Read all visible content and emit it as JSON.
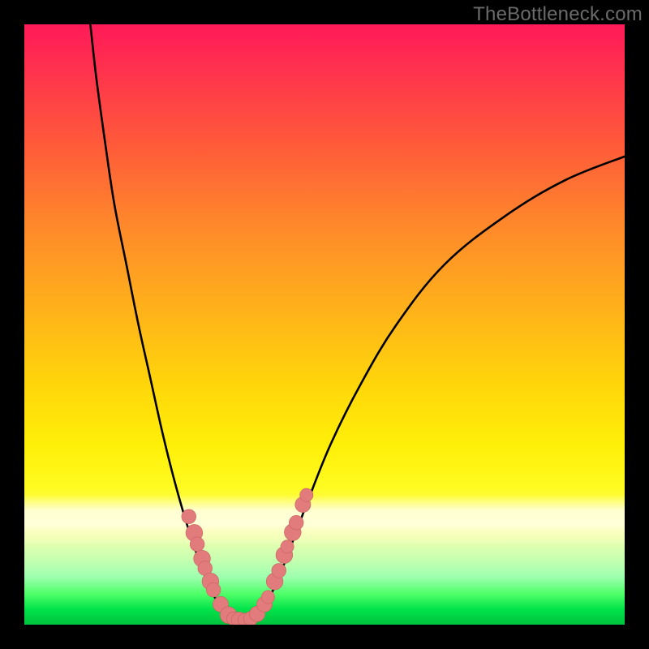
{
  "watermark": "TheBottleneck.com",
  "colors": {
    "page_bg": "#000000",
    "gradient_top": "#ff1a58",
    "gradient_mid_orange": "#ff8a2a",
    "gradient_yellow": "#ffef08",
    "gradient_green": "#00e24a",
    "curve_stroke": "#000000",
    "marker_fill": "#e27b7b",
    "marker_stroke": "#c86262"
  },
  "chart_data": {
    "type": "line",
    "title": "",
    "xlabel": "",
    "ylabel": "",
    "xlim": [
      0,
      100
    ],
    "ylim": [
      0,
      100
    ],
    "grid": false,
    "legend": false,
    "left_curve": {
      "name": "left-branch",
      "points": [
        [
          11.0,
          100.0
        ],
        [
          12.0,
          91.0
        ],
        [
          13.5,
          80.0
        ],
        [
          15.0,
          70.0
        ],
        [
          17.0,
          60.0
        ],
        [
          19.0,
          50.0
        ],
        [
          21.0,
          41.0
        ],
        [
          23.0,
          32.0
        ],
        [
          25.0,
          24.0
        ],
        [
          27.0,
          17.0
        ],
        [
          29.0,
          11.0
        ],
        [
          31.0,
          6.0
        ],
        [
          33.0,
          2.5
        ],
        [
          35.0,
          0.8
        ]
      ]
    },
    "right_curve": {
      "name": "right-branch",
      "points": [
        [
          38.0,
          0.8
        ],
        [
          40.0,
          3.0
        ],
        [
          42.0,
          7.0
        ],
        [
          44.0,
          12.0
        ],
        [
          47.0,
          20.0
        ],
        [
          51.0,
          30.0
        ],
        [
          56.0,
          40.0
        ],
        [
          62.0,
          50.0
        ],
        [
          70.0,
          60.0
        ],
        [
          80.0,
          68.0
        ],
        [
          90.0,
          74.0
        ],
        [
          100.0,
          78.0
        ]
      ]
    },
    "bottom_segment": {
      "name": "bottom-connector",
      "points": [
        [
          35.0,
          0.8
        ],
        [
          36.5,
          0.6
        ],
        [
          38.0,
          0.8
        ]
      ]
    },
    "markers": [
      {
        "x": 27.4,
        "y": 18.0,
        "r": 1.2
      },
      {
        "x": 28.3,
        "y": 15.3,
        "r": 1.4
      },
      {
        "x": 28.8,
        "y": 13.4,
        "r": 1.2
      },
      {
        "x": 29.6,
        "y": 11.0,
        "r": 1.4
      },
      {
        "x": 30.1,
        "y": 9.4,
        "r": 1.2
      },
      {
        "x": 31.0,
        "y": 7.2,
        "r": 1.4
      },
      {
        "x": 31.5,
        "y": 5.8,
        "r": 1.2
      },
      {
        "x": 32.7,
        "y": 3.4,
        "r": 1.3
      },
      {
        "x": 34.0,
        "y": 1.6,
        "r": 1.4
      },
      {
        "x": 34.8,
        "y": 1.0,
        "r": 1.1
      },
      {
        "x": 35.8,
        "y": 0.8,
        "r": 1.3
      },
      {
        "x": 36.7,
        "y": 0.8,
        "r": 1.1
      },
      {
        "x": 37.7,
        "y": 1.0,
        "r": 1.2
      },
      {
        "x": 38.8,
        "y": 1.8,
        "r": 1.3
      },
      {
        "x": 40.0,
        "y": 3.4,
        "r": 1.3
      },
      {
        "x": 40.6,
        "y": 4.6,
        "r": 1.1
      },
      {
        "x": 41.7,
        "y": 7.2,
        "r": 1.4
      },
      {
        "x": 42.4,
        "y": 9.0,
        "r": 1.2
      },
      {
        "x": 43.3,
        "y": 11.6,
        "r": 1.4
      },
      {
        "x": 43.8,
        "y": 13.0,
        "r": 1.1
      },
      {
        "x": 44.7,
        "y": 15.4,
        "r": 1.4
      },
      {
        "x": 45.3,
        "y": 17.0,
        "r": 1.2
      },
      {
        "x": 46.4,
        "y": 20.0,
        "r": 1.3
      },
      {
        "x": 47.0,
        "y": 21.6,
        "r": 1.1
      }
    ]
  }
}
